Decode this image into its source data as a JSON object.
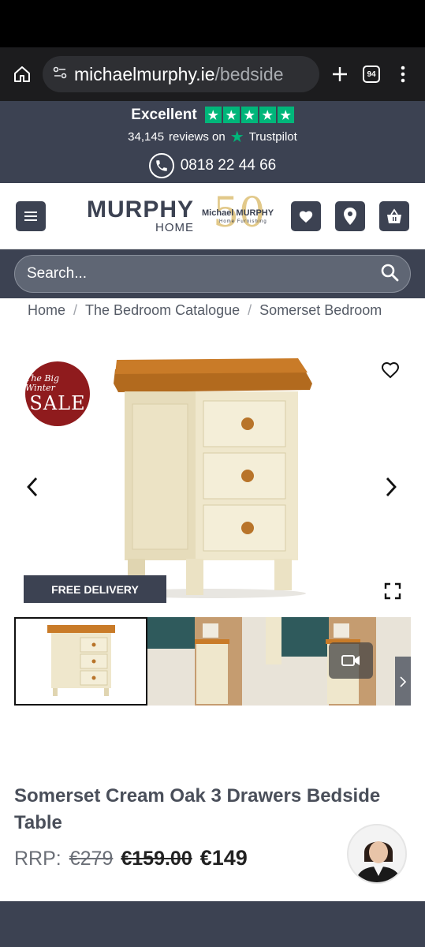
{
  "browser": {
    "url_host": "michaelmurphy.ie",
    "url_path": "/bedside",
    "tab_count": "94"
  },
  "trust": {
    "rating_label": "Excellent",
    "reviews_count": "34,145",
    "reviews_on": "reviews on",
    "provider": "Trustpilot",
    "phone": "0818 22 44 66"
  },
  "logo": {
    "main": "MURPHY",
    "sub": "HOME",
    "anniversary_number": "50",
    "anniversary_brand": "Michael MURPHY",
    "anniversary_tagline": "Home Furnishing"
  },
  "search": {
    "placeholder": "Search..."
  },
  "breadcrumb": {
    "items": [
      "Home",
      "The Bedroom Catalogue",
      "Somerset Bedroom"
    ]
  },
  "gallery": {
    "sale_badge_top": "The Big Winter",
    "sale_badge_main": "SALE",
    "free_delivery": "FREE DELIVERY"
  },
  "product": {
    "title": "Somerset Cream Oak 3 Drawers Bedside Table",
    "rrp_label": "RRP:",
    "rrp_value": "€279",
    "was_price": "€159.00",
    "now_price": "€149"
  },
  "colors": {
    "brand_dark": "#3c4252",
    "trustpilot_green": "#00b67a",
    "sale_red": "#8f1b1d"
  }
}
